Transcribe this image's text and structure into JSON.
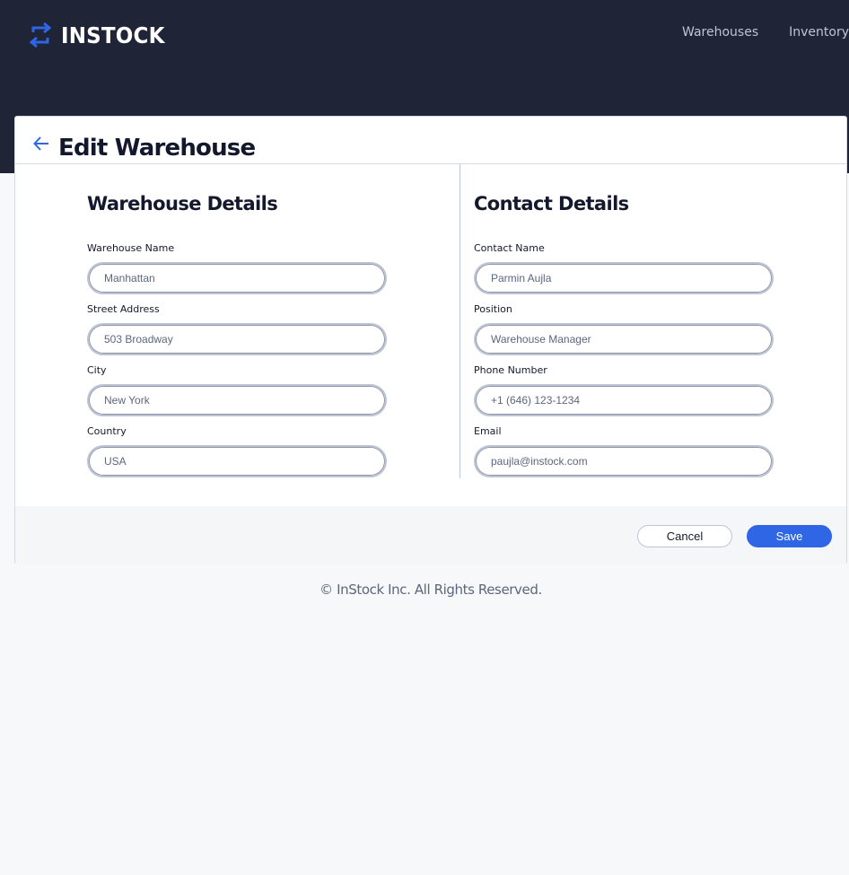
{
  "brand": {
    "name": "INSTOCK",
    "accent": "#2E66E5",
    "logo_icon": "swap-arrows-icon"
  },
  "nav": {
    "items": [
      "Warehouses",
      "Inventory"
    ]
  },
  "page": {
    "title": "Edit Warehouse",
    "back_icon": "arrow-back-icon"
  },
  "warehouse": {
    "title": "Warehouse Details",
    "fields": [
      {
        "label": "Warehouse Name",
        "value": "Manhattan"
      },
      {
        "label": "Street Address",
        "value": "503 Broadway"
      },
      {
        "label": "City",
        "value": "New York"
      },
      {
        "label": "Country",
        "value": "USA"
      }
    ]
  },
  "contact": {
    "title": "Contact Details",
    "fields": [
      {
        "label": "Contact Name",
        "value": "Parmin Aujla"
      },
      {
        "label": "Position",
        "value": "Warehouse Manager"
      },
      {
        "label": "Phone Number",
        "value": "+1 (646) 123-1234"
      },
      {
        "label": "Email",
        "value": "paujla@instock.com"
      }
    ]
  },
  "actions": {
    "cancel": "Cancel",
    "save": "Save"
  },
  "footer": {
    "copyright": "© InStock Inc. All Rights Reserved."
  }
}
